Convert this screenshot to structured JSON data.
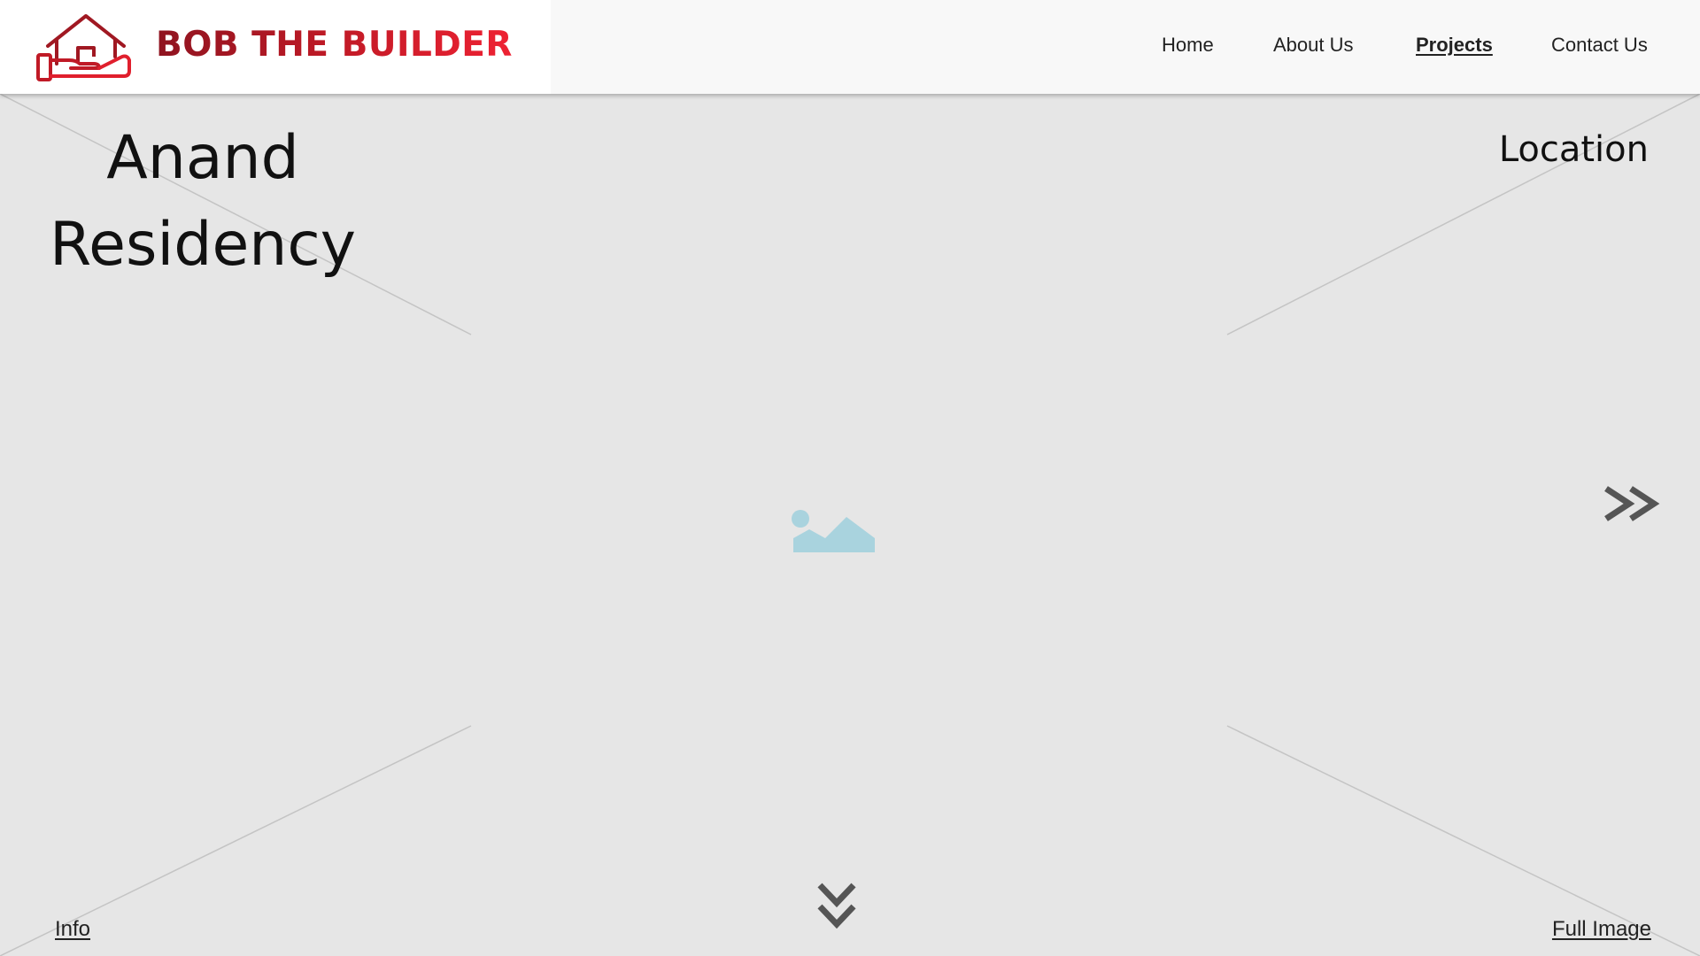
{
  "brand": {
    "name": "BOB THE BUILDER",
    "colors": {
      "primary": "#c01a26",
      "dark": "#8f1420",
      "light": "#ee2233"
    },
    "logo_icon": "house-in-hand-icon"
  },
  "nav": {
    "items": [
      {
        "label": "Home",
        "active": false
      },
      {
        "label": "About Us",
        "active": false
      },
      {
        "label": "Projects",
        "active": true
      },
      {
        "label": "Contact Us",
        "active": false
      }
    ]
  },
  "project": {
    "title_line1": "Anand",
    "title_line2": "Residency",
    "location_label": "Location"
  },
  "hero": {
    "placeholder_icon": "image-placeholder-icon",
    "placeholder_color": "#a9d3de",
    "next_icon": "double-chevron-right-icon",
    "scroll_icon": "double-chevron-down-icon"
  },
  "footer_links": {
    "info": "Info",
    "full_image": "Full Image"
  }
}
